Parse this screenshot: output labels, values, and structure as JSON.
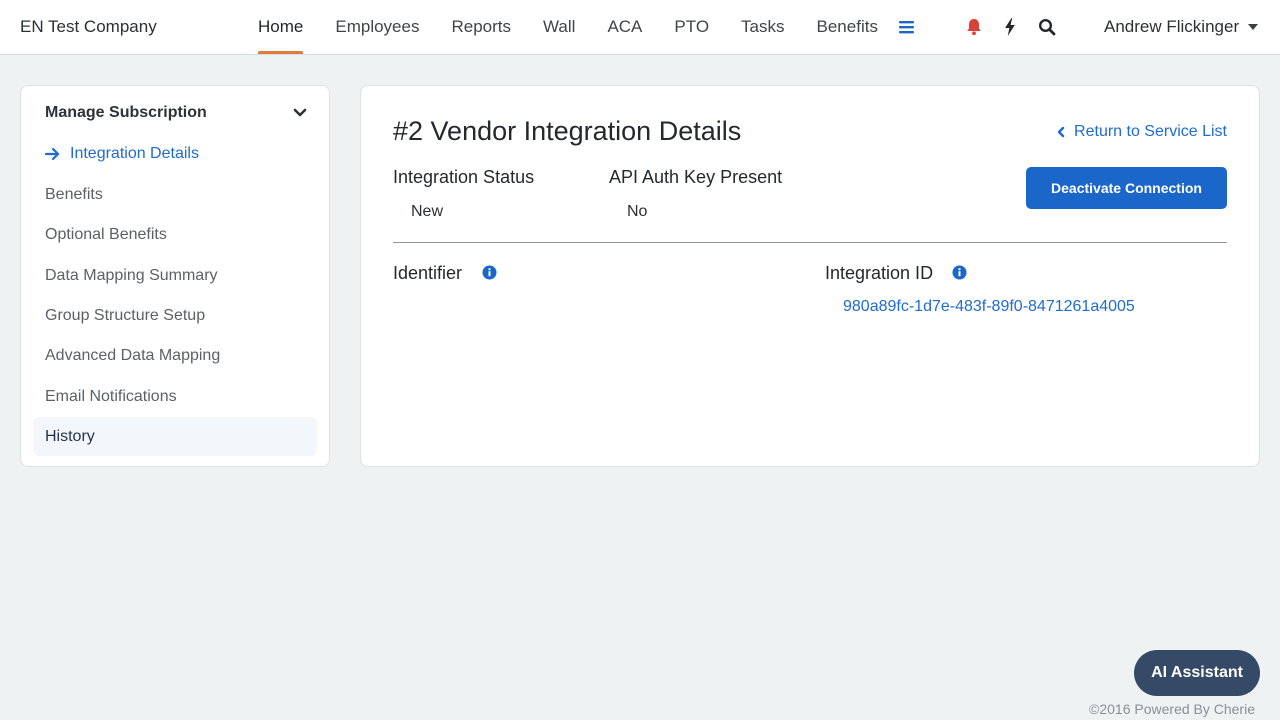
{
  "header": {
    "company": "EN Test Company",
    "nav": [
      {
        "label": "Home",
        "active": true
      },
      {
        "label": "Employees"
      },
      {
        "label": "Reports"
      },
      {
        "label": "Wall"
      },
      {
        "label": "ACA"
      },
      {
        "label": "PTO"
      },
      {
        "label": "Tasks"
      },
      {
        "label": "Benefits"
      }
    ],
    "icons": [
      "menu-icon",
      "bell-icon",
      "bolt-icon",
      "search-icon"
    ],
    "user": "Andrew Flickinger"
  },
  "sidebar": {
    "title": "Manage Subscription",
    "items": [
      {
        "label": "Integration Details",
        "current": true
      },
      {
        "label": "Benefits"
      },
      {
        "label": "Optional Benefits"
      },
      {
        "label": "Data Mapping Summary"
      },
      {
        "label": "Group Structure Setup"
      },
      {
        "label": "Advanced Data Mapping"
      },
      {
        "label": "Email Notifications"
      },
      {
        "label": "History",
        "hovered": true
      }
    ]
  },
  "main": {
    "title": "#2 Vendor Integration Details",
    "return_link": "Return to Service List",
    "status_label": "Integration Status",
    "status_value": "New",
    "api_label": "API Auth Key Present",
    "api_value": "No",
    "deactivate": "Deactivate Connection",
    "identifier_label": "Identifier",
    "integration_id_label": "Integration ID",
    "integration_id_value": "980a89fc-1d7e-483f-89f0-8471261a4005"
  },
  "assistant": "AI Assistant",
  "footer": "©2016 Powered By Cherie",
  "colors": {
    "accent": "#1b67c9",
    "nav_underline": "#e07b39",
    "bell": "#d9423a",
    "assistant_bg": "#344a66",
    "page_bg": "#eff2f3"
  }
}
